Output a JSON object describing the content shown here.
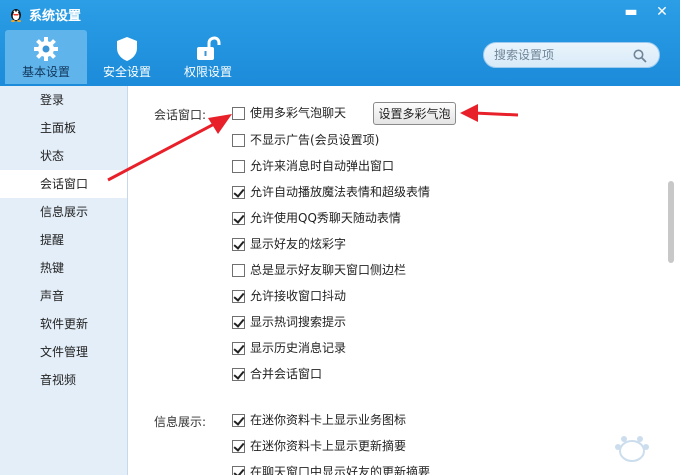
{
  "window": {
    "title": "系统设置",
    "minimize_glyph": "▬",
    "close_glyph": "✕"
  },
  "toolbar": {
    "tabs": [
      {
        "label": "基本设置",
        "icon": "gear-icon",
        "active": true
      },
      {
        "label": "安全设置",
        "icon": "shield-icon",
        "active": false
      },
      {
        "label": "权限设置",
        "icon": "unlock-icon",
        "active": false
      }
    ]
  },
  "search": {
    "placeholder": "搜索设置项",
    "value": ""
  },
  "sidebar": {
    "items": [
      {
        "label": "登录"
      },
      {
        "label": "主面板"
      },
      {
        "label": "状态"
      },
      {
        "label": "会话窗口",
        "active": true
      },
      {
        "label": "信息展示"
      },
      {
        "label": "提醒"
      },
      {
        "label": "热键"
      },
      {
        "label": "声音"
      },
      {
        "label": "软件更新"
      },
      {
        "label": "文件管理"
      },
      {
        "label": "音视频"
      }
    ]
  },
  "session_window": {
    "label": "会话窗口:",
    "bubble_button": "设置多彩气泡",
    "options": [
      {
        "label": "使用多彩气泡聊天",
        "checked": false
      },
      {
        "label": "不显示广告(会员设置项)",
        "checked": false
      },
      {
        "label": "允许来消息时自动弹出窗口",
        "checked": false
      },
      {
        "label": "允许自动播放魔法表情和超级表情",
        "checked": true
      },
      {
        "label": "允许使用QQ秀聊天随动表情",
        "checked": true
      },
      {
        "label": "显示好友的炫彩字",
        "checked": true
      },
      {
        "label": "总是显示好友聊天窗口侧边栏",
        "checked": false
      },
      {
        "label": "允许接收窗口抖动",
        "checked": true
      },
      {
        "label": "显示热词搜索提示",
        "checked": true
      },
      {
        "label": "显示历史消息记录",
        "checked": true
      },
      {
        "label": "合并会话窗口",
        "checked": true
      }
    ]
  },
  "info_display": {
    "label": "信息展示:",
    "options": [
      {
        "label": "在迷你资料卡上显示业务图标",
        "checked": true
      },
      {
        "label": "在迷你资料卡上显示更新摘要",
        "checked": true
      },
      {
        "label": "在聊天窗口中显示好友的更新摘要",
        "checked": true
      }
    ]
  },
  "colors": {
    "titlebar": "#1b8ad9",
    "active_tab": "#5fb4ec",
    "sidebar_bg": "#e3eef8",
    "annotation_arrow": "#e8202a"
  }
}
